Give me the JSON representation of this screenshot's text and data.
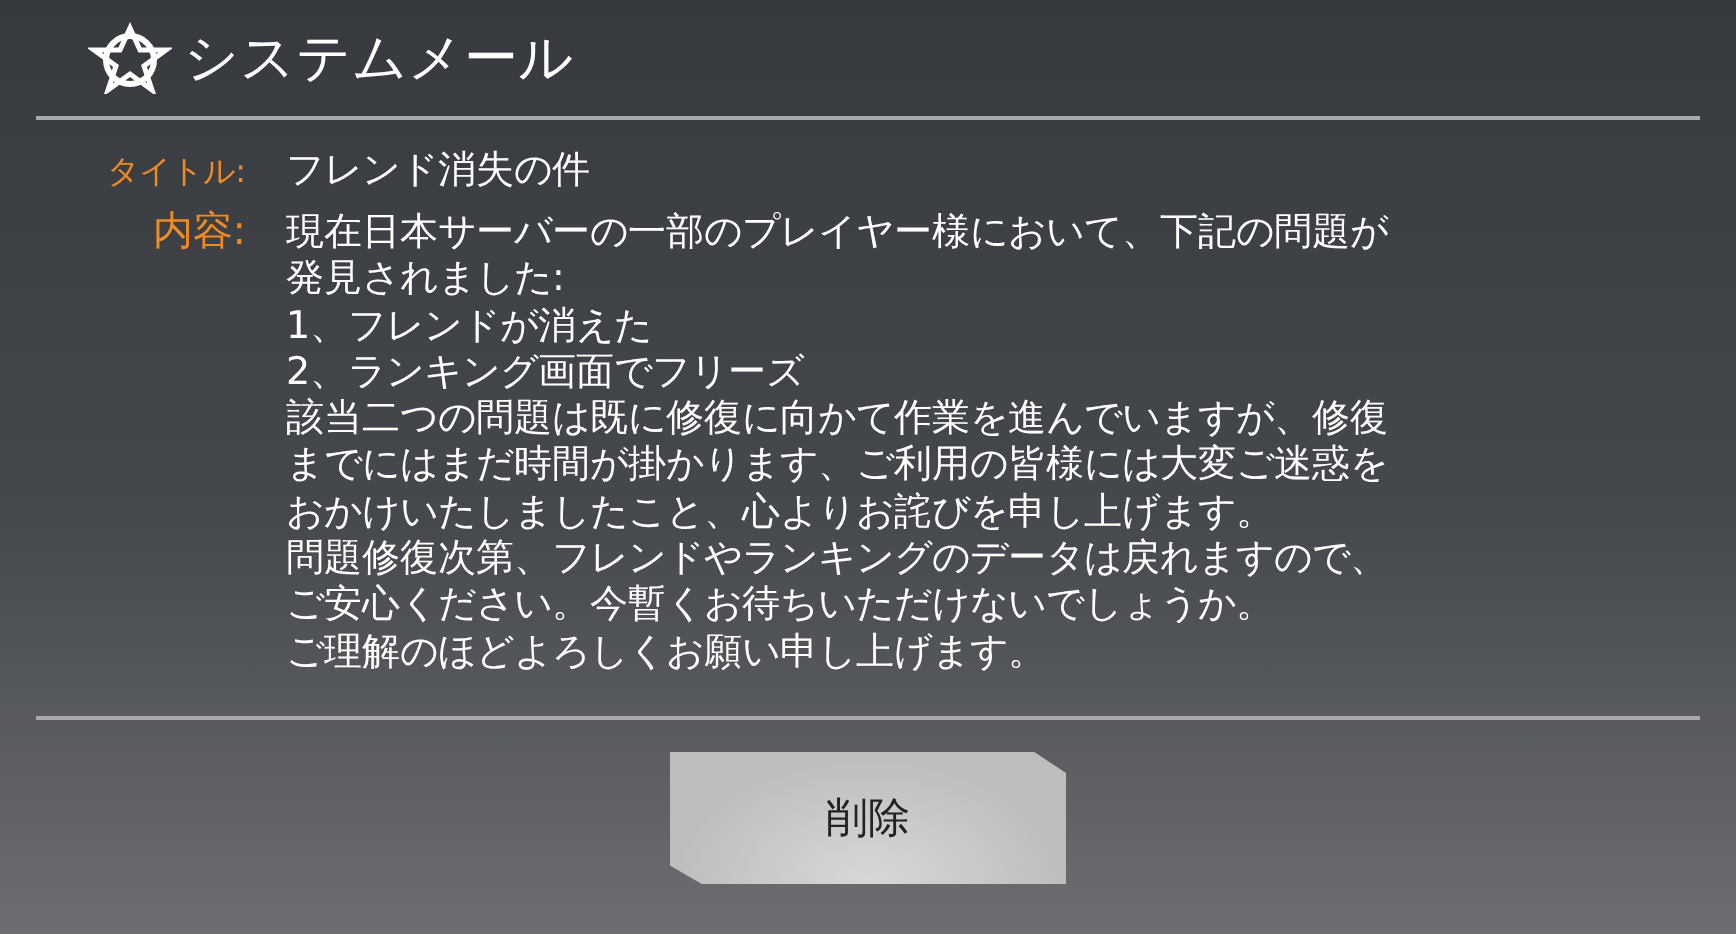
{
  "window": {
    "title": "システムメール"
  },
  "mail": {
    "title_label": "タイトル:",
    "title": "フレンド消失の件",
    "content_label": "内容:",
    "content_lines": [
      "現在日本サーバーの一部のプレイヤー様において、下記の問題が",
      "発見されました:",
      "1、フレンドが消えた",
      "2、ランキング画面でフリーズ",
      "該当二つの問題は既に修復に向かて作業を進んでいますが、修復",
      "までにはまだ時間が掛かります、ご利用の皆様には大変ご迷惑を",
      "おかけいたしましたこと、心よりお詫びを申し上げます。",
      "問題修復次第、フレンドやランキングのデータは戻れますので、",
      "ご安心ください。今暫くお待ちいただけないでしょうか。",
      "ご理解のほどよろしくお願い申し上げます。"
    ]
  },
  "buttons": [
    {
      "label": "削除"
    }
  ]
}
